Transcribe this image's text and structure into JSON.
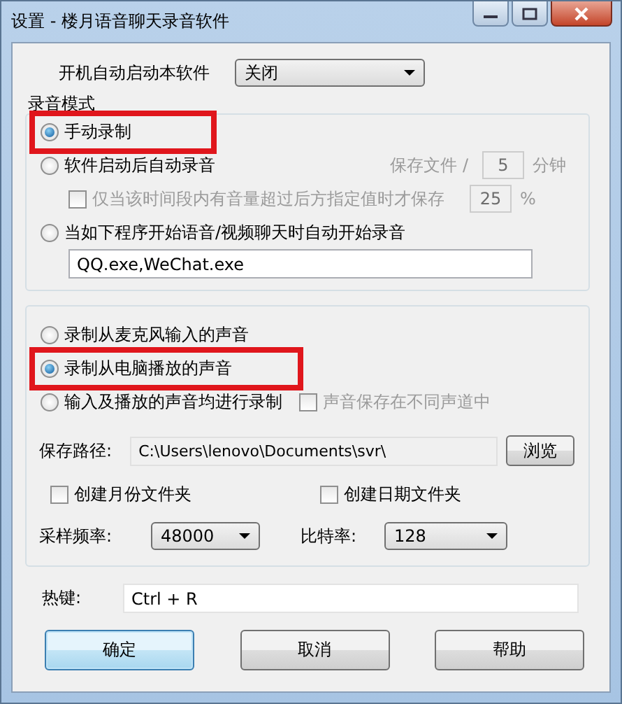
{
  "window": {
    "title": "设置 - 楼月语音聊天录音软件"
  },
  "startup": {
    "label": "开机自动启动本软件",
    "value": "关闭"
  },
  "recording_mode": {
    "title": "录音模式",
    "options": [
      {
        "label": "手动录制",
        "selected": true,
        "highlighted": true
      },
      {
        "label": "软件启动后自动录音",
        "selected": false,
        "highlighted": false
      },
      {
        "label": "当如下程序开始语音/视频聊天时自动开始录音",
        "selected": false,
        "highlighted": false
      }
    ],
    "save_interval": {
      "label": "保存文件 /",
      "value": "5",
      "unit": "分钟",
      "disabled": true
    },
    "threshold": {
      "label": "仅当该时间段内有音量超过后方指定值时才保存",
      "checked": false,
      "disabled": true,
      "value": "25",
      "unit": "%"
    },
    "programs": {
      "value": "QQ.exe,WeChat.exe"
    }
  },
  "source": {
    "options": [
      {
        "label": "录制从麦克风输入的声音",
        "selected": false,
        "highlighted": false
      },
      {
        "label": "录制从电脑播放的声音",
        "selected": true,
        "highlighted": true
      },
      {
        "label": "输入及播放的声音均进行录制",
        "selected": false,
        "highlighted": false
      }
    ],
    "separate_channels": {
      "label": "声音保存在不同声道中",
      "checked": false,
      "disabled": true
    },
    "path": {
      "label": "保存路径:",
      "value": "C:\\Users\\lenovo\\Documents\\svr\\",
      "button": "浏览"
    },
    "folders": [
      {
        "label": "创建月份文件夹",
        "checked": false
      },
      {
        "label": "创建日期文件夹",
        "checked": false
      }
    ],
    "sample_rate": {
      "label": "采样频率:",
      "value": "48000"
    },
    "bitrate": {
      "label": "比特率:",
      "value": "128"
    }
  },
  "hotkey": {
    "label": "热键:",
    "value": "Ctrl + R"
  },
  "buttons": [
    {
      "label": "确定",
      "default": true
    },
    {
      "label": "取消",
      "default": false
    },
    {
      "label": "帮助",
      "default": false
    }
  ]
}
